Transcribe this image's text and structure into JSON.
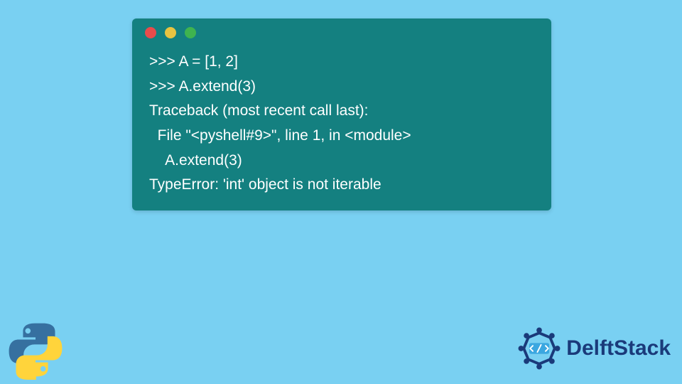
{
  "terminal": {
    "traffic_lights": [
      "red",
      "yellow",
      "green"
    ],
    "lines": [
      ">>> A = [1, 2]",
      ">>> A.extend(3)",
      "Traceback (most recent call last):",
      "  File \"<pyshell#9>\", line 1, in <module>",
      "    A.extend(3)",
      "TypeError: 'int' object is not iterable"
    ]
  },
  "branding": {
    "delftstack_label": "DelftStack"
  },
  "colors": {
    "background": "#79d0f2",
    "terminal_bg": "#148080",
    "terminal_text": "#ffffff",
    "brand_text": "#1a3a7a",
    "python_blue": "#3670a0",
    "python_yellow": "#ffd43b"
  }
}
